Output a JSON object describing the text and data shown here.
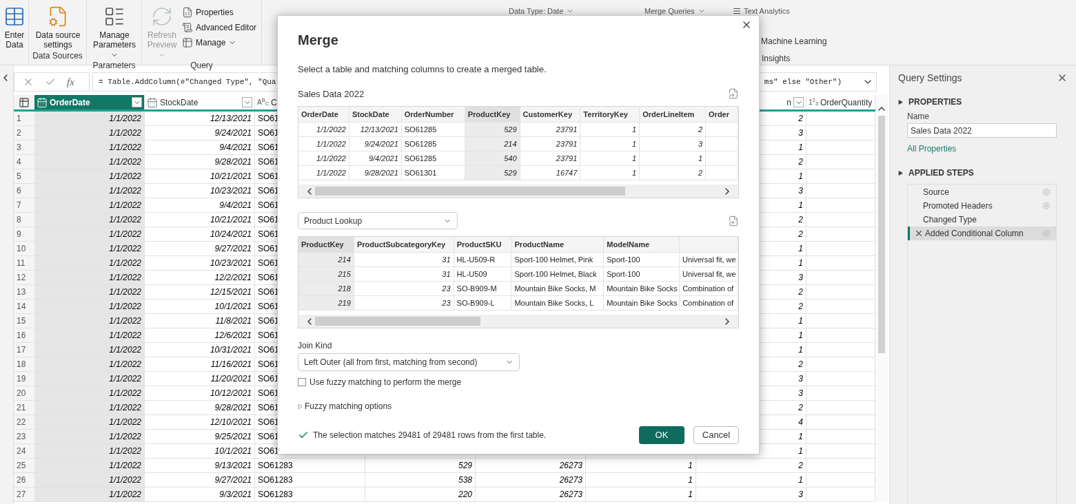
{
  "ribbon": {
    "large_buttons": [
      {
        "label": "Enter Data",
        "dropdown": false,
        "disabled": false
      },
      {
        "label": "Data source settings",
        "dropdown": false,
        "disabled": false
      },
      {
        "label": "Manage Parameters",
        "dropdown": true,
        "disabled": false
      },
      {
        "label": "Refresh Preview",
        "dropdown": true,
        "disabled": true
      }
    ],
    "small_buttons": [
      {
        "label": "Properties",
        "dropdown": false
      },
      {
        "label": "Advanced Editor",
        "dropdown": false
      },
      {
        "label": "Manage",
        "dropdown": true
      }
    ],
    "group_labels": [
      "Data Sources",
      "Parameters",
      "Query"
    ],
    "top_items": [
      {
        "label": "Data Type: Date",
        "dropdown": true
      },
      {
        "label": "Merge Queries",
        "dropdown": true
      },
      {
        "label": "Text Analytics",
        "dropdown": false
      }
    ],
    "right_item": "Machine Learning",
    "right_group_label": "Insights"
  },
  "formula_bar": {
    "fx_label": "fx",
    "text_left": "= Table.AddColumn(#\"Changed Type\", \"Qua",
    "text_right": "ms\" else \"Other\")"
  },
  "grid": {
    "columns": [
      {
        "label": "OrderDate",
        "kind": "date",
        "dropdown": true,
        "selected": true
      },
      {
        "label": "StockDate",
        "kind": "date",
        "dropdown": true,
        "selected": false
      },
      {
        "label": "C",
        "kind": "text",
        "type_glyph": "A$^{B}$$_{C}$",
        "selected": false
      },
      {
        "kind": "number"
      },
      {
        "kind": "number"
      },
      {
        "kind": "number"
      },
      {
        "label": "n",
        "kind": "number",
        "dropdown": true,
        "selected": false
      },
      {
        "label": "OrderQuantity",
        "kind": "number",
        "type_glyph": "1$^{2}$$_{3}$",
        "dropdown": false,
        "selected": false
      }
    ],
    "rows": [
      {
        "n": "1",
        "cells": [
          "1/1/2022",
          "12/13/2021",
          "SO61",
          null,
          null,
          null,
          "2"
        ]
      },
      {
        "n": "2",
        "cells": [
          "1/1/2022",
          "9/24/2021",
          "SO61",
          null,
          null,
          null,
          "3"
        ]
      },
      {
        "n": "3",
        "cells": [
          "1/1/2022",
          "9/4/2021",
          "SO61",
          null,
          null,
          null,
          "1"
        ]
      },
      {
        "n": "4",
        "cells": [
          "1/1/2022",
          "9/28/2021",
          "SO61",
          null,
          null,
          null,
          "2"
        ]
      },
      {
        "n": "5",
        "cells": [
          "1/1/2022",
          "10/21/2021",
          "SO61",
          null,
          null,
          null,
          "1"
        ]
      },
      {
        "n": "6",
        "cells": [
          "1/1/2022",
          "10/23/2021",
          "SO61",
          null,
          null,
          null,
          "3"
        ]
      },
      {
        "n": "7",
        "cells": [
          "1/1/2022",
          "9/4/2021",
          "SO61",
          null,
          null,
          null,
          "1"
        ]
      },
      {
        "n": "8",
        "cells": [
          "1/1/2022",
          "10/21/2021",
          "SO61",
          null,
          null,
          null,
          "2"
        ]
      },
      {
        "n": "9",
        "cells": [
          "1/1/2022",
          "10/24/2021",
          "SO61",
          null,
          null,
          null,
          "2"
        ]
      },
      {
        "n": "10",
        "cells": [
          "1/1/2022",
          "9/27/2021",
          "SO61",
          null,
          null,
          null,
          "1"
        ]
      },
      {
        "n": "11",
        "cells": [
          "1/1/2022",
          "10/23/2021",
          "SO61",
          null,
          null,
          null,
          "1"
        ]
      },
      {
        "n": "12",
        "cells": [
          "1/1/2022",
          "12/2/2021",
          "SO61",
          null,
          null,
          null,
          "3"
        ]
      },
      {
        "n": "13",
        "cells": [
          "1/1/2022",
          "12/15/2021",
          "SO61",
          null,
          null,
          null,
          "2"
        ]
      },
      {
        "n": "14",
        "cells": [
          "1/1/2022",
          "10/1/2021",
          "SO61",
          null,
          null,
          null,
          "2"
        ]
      },
      {
        "n": "15",
        "cells": [
          "1/1/2022",
          "11/8/2021",
          "SO61",
          null,
          null,
          null,
          "1"
        ]
      },
      {
        "n": "16",
        "cells": [
          "1/1/2022",
          "12/6/2021",
          "SO61",
          null,
          null,
          null,
          "1"
        ]
      },
      {
        "n": "17",
        "cells": [
          "1/1/2022",
          "10/31/2021",
          "SO61",
          null,
          null,
          null,
          "1"
        ]
      },
      {
        "n": "18",
        "cells": [
          "1/1/2022",
          "11/16/2021",
          "SO61",
          null,
          null,
          null,
          "2"
        ]
      },
      {
        "n": "19",
        "cells": [
          "1/1/2022",
          "11/20/2021",
          "SO61",
          null,
          null,
          null,
          "3"
        ]
      },
      {
        "n": "20",
        "cells": [
          "1/1/2022",
          "10/12/2021",
          "SO61",
          null,
          null,
          null,
          "3"
        ]
      },
      {
        "n": "21",
        "cells": [
          "1/1/2022",
          "9/28/2021",
          "SO61",
          null,
          null,
          null,
          "2"
        ]
      },
      {
        "n": "22",
        "cells": [
          "1/1/2022",
          "12/10/2021",
          "SO61",
          null,
          null,
          null,
          "4"
        ]
      },
      {
        "n": "23",
        "cells": [
          "1/1/2022",
          "9/25/2021",
          "SO61",
          null,
          null,
          null,
          "1"
        ]
      },
      {
        "n": "24",
        "cells": [
          "1/1/2022",
          "10/1/2021",
          "SO61",
          null,
          null,
          null,
          "1"
        ]
      },
      {
        "n": "25",
        "cells": [
          "1/1/2022",
          "9/13/2021",
          "SO61283",
          "529",
          "26273",
          "1",
          "2"
        ]
      },
      {
        "n": "26",
        "cells": [
          "1/1/2022",
          "9/27/2021",
          "SO61283",
          "538",
          "26273",
          "1",
          "1"
        ]
      },
      {
        "n": "27",
        "cells": [
          "1/1/2022",
          "9/3/2021",
          "SO61283",
          "220",
          "26273",
          "1",
          "3"
        ]
      }
    ]
  },
  "query_settings": {
    "title": "Query Settings",
    "properties_heading": "PROPERTIES",
    "name_label": "Name",
    "name_value": "Sales Data 2022",
    "all_properties": "All Properties",
    "steps_heading": "APPLIED STEPS",
    "steps": [
      {
        "label": "Source",
        "has_settings": true,
        "selected": false
      },
      {
        "label": "Promoted Headers",
        "has_settings": true,
        "selected": false
      },
      {
        "label": "Changed Type",
        "has_settings": false,
        "selected": false
      },
      {
        "label": "Added Conditional Column",
        "has_settings": true,
        "selected": true
      }
    ]
  },
  "dialog": {
    "title": "Merge",
    "subtitle": "Select a table and matching columns to create a merged table.",
    "first_table": {
      "title": "Sales Data 2022",
      "columns": [
        {
          "label": "OrderDate",
          "kind": "date",
          "selected": false
        },
        {
          "label": "StockDate",
          "kind": "date",
          "selected": false
        },
        {
          "label": "OrderNumber",
          "kind": "text",
          "selected": false
        },
        {
          "label": "ProductKey",
          "kind": "number",
          "selected": true
        },
        {
          "label": "CustomerKey",
          "kind": "number",
          "selected": false
        },
        {
          "label": "TerritoryKey",
          "kind": "number",
          "selected": false
        },
        {
          "label": "OrderLineItem",
          "kind": "number",
          "selected": false
        },
        {
          "label": "Order",
          "kind": "number",
          "selected": false
        }
      ],
      "rows": [
        [
          "1/1/2022",
          "12/13/2021",
          "SO61285",
          "529",
          "23791",
          "1",
          "2"
        ],
        [
          "1/1/2022",
          "9/24/2021",
          "SO61285",
          "214",
          "23791",
          "1",
          "3"
        ],
        [
          "1/1/2022",
          "9/4/2021",
          "SO61285",
          "540",
          "23791",
          "1",
          "1"
        ],
        [
          "1/1/2022",
          "9/28/2021",
          "SO61301",
          "529",
          "16747",
          "1",
          "2"
        ]
      ]
    },
    "second_table": {
      "source": "Product Lookup",
      "columns": [
        {
          "label": "ProductKey",
          "kind": "number",
          "selected": true
        },
        {
          "label": "ProductSubcategoryKey",
          "kind": "number",
          "selected": false
        },
        {
          "label": "ProductSKU",
          "kind": "text",
          "selected": false
        },
        {
          "label": "ProductName",
          "kind": "text",
          "selected": false
        },
        {
          "label": "ModelName",
          "kind": "text",
          "selected": false
        },
        {
          "kind": "text",
          "selected": false
        }
      ],
      "rows": [
        [
          "214",
          "31",
          "HL-U509-R",
          "Sport-100 Helmet, Pink",
          "Sport-100",
          "Universal fit, we"
        ],
        [
          "215",
          "31",
          "HL-U509",
          "Sport-100 Helmet, Black",
          "Sport-100",
          "Universal fit, we"
        ],
        [
          "218",
          "23",
          "SO-B909-M",
          "Mountain Bike Socks, M",
          "Mountain Bike Socks",
          "Combination of"
        ],
        [
          "219",
          "23",
          "SO-B909-L",
          "Mountain Bike Socks, L",
          "Mountain Bike Socks",
          "Combination of"
        ]
      ]
    },
    "join_kind": {
      "label": "Join Kind",
      "value": "Left Outer (all from first, matching from second)"
    },
    "fuzzy": {
      "label": "Use fuzzy matching to perform the merge",
      "checked": false
    },
    "fuzzy_options": {
      "label": "Fuzzy matching options",
      "expanded": false
    },
    "status": {
      "text": "The selection matches 29481 of 29481 rows from the first table.",
      "ok": true
    },
    "buttons": [
      {
        "label": "OK",
        "kind": "primary"
      },
      {
        "label": "Cancel",
        "kind": "secondary"
      }
    ]
  }
}
